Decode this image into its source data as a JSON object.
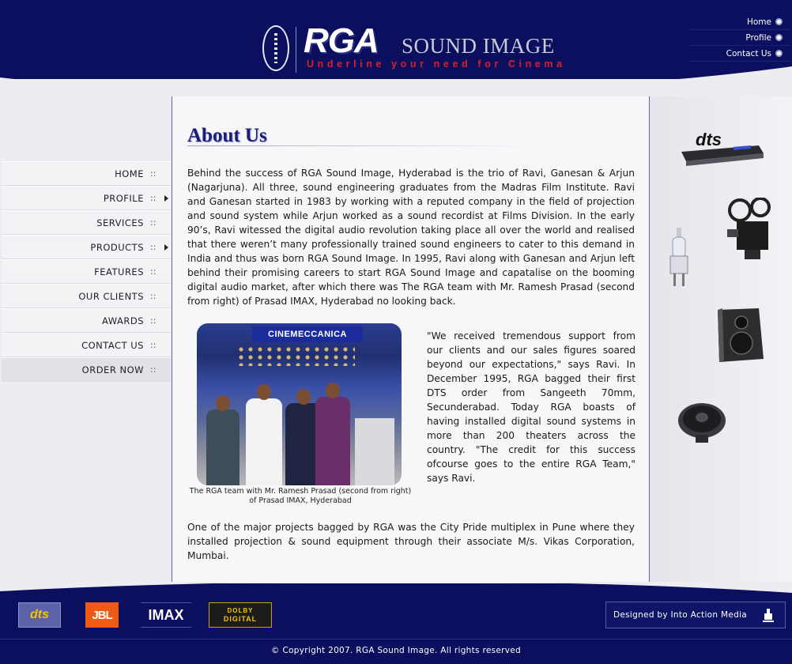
{
  "header": {
    "logo_rga": "RGA",
    "logo_sound_image": "SOUND IMAGE",
    "tagline": "Underline your need for Cinema",
    "top_nav": [
      {
        "label": "Home"
      },
      {
        "label": "Profile"
      },
      {
        "label": "Contact Us"
      }
    ]
  },
  "sidebar": {
    "items": [
      {
        "label": "HOME",
        "sep": "::"
      },
      {
        "label": "PROFILE",
        "sep": "::",
        "has_submenu": true
      },
      {
        "label": "SERVICES",
        "sep": "::"
      },
      {
        "label": "PRODUCTS",
        "sep": "::",
        "has_submenu": true
      },
      {
        "label": "FEATURES",
        "sep": "::"
      },
      {
        "label": "OUR CLIENTS",
        "sep": "::"
      },
      {
        "label": "AWARDS",
        "sep": "::"
      },
      {
        "label": "CONTACT US",
        "sep": "::"
      },
      {
        "label": "ORDER NOW",
        "sep": "::",
        "highlighted": true
      }
    ]
  },
  "main": {
    "title": "About Us",
    "paragraph_1": "Behind the success of RGA Sound Image, Hyderabad is the trio of Ravi, Ganesan & Arjun (Nagarjuna). All three, sound engineering graduates from the Madras Film Institute. Ravi and Ganesan started in 1983 by working with a reputed company in the field of projection and sound system while Arjun worked as a sound recordist at Films Division. In the early 90’s, Ravi witessed the digital audio revolution taking place all over the world and realised that there weren’t many professionally trained sound engineers to cater to this demand in India and thus was born RGA Sound Image. In 1995, Ravi along with Ganesan and Arjun left behind their promising careers to start RGA Sound Image and capatalise on the booming digital audio market, after which there was The RGA team with Mr. Ramesh Prasad (second from right) of Prasad IMAX, Hyderabad no looking back.",
    "photo_banner": "CINEMECCANICA",
    "photo_caption": "The RGA team with Mr. Ramesh Prasad (second from right) of Prasad IMAX, Hyderabad",
    "quote": "\"We received tremendous support from our clients and our sales figures soared beyond our expectations,\" says Ravi. In December 1995, RGA bagged their first DTS order from Sangeeth 70mm, Secunderabad. Today RGA boasts of having installed digital sound systems in more than 200 theaters across the country. \"The credit for this success ofcourse goes to the entire RGA Team,\" says Ravi.",
    "paragraph_2": "One of the major projects bagged by RGA was the City Pride multiplex in Pune where they installed projection & sound equipment through their associate M/s. Vikas Corporation, Mumbai."
  },
  "right_column": {
    "dts_label": "dts",
    "products": [
      "dts-processor",
      "film-projector",
      "projector-lamp",
      "speaker-cabinet",
      "woofer-driver"
    ]
  },
  "footer": {
    "brands": {
      "dts": "dts",
      "jbl": "JBL",
      "imax": "IMAX",
      "dolby_top": "DOLBY",
      "dolby_bottom": "DIGITAL"
    },
    "designer": "Designed by Into Action Media",
    "copyright": "© Copyright 2007. RGA Sound Image. All rights reserved"
  },
  "colors": {
    "navy": "#0b0f5e",
    "title_blue": "#1a1d7a",
    "tagline_red": "#d8202a",
    "panel_gray": "#ececf1"
  }
}
